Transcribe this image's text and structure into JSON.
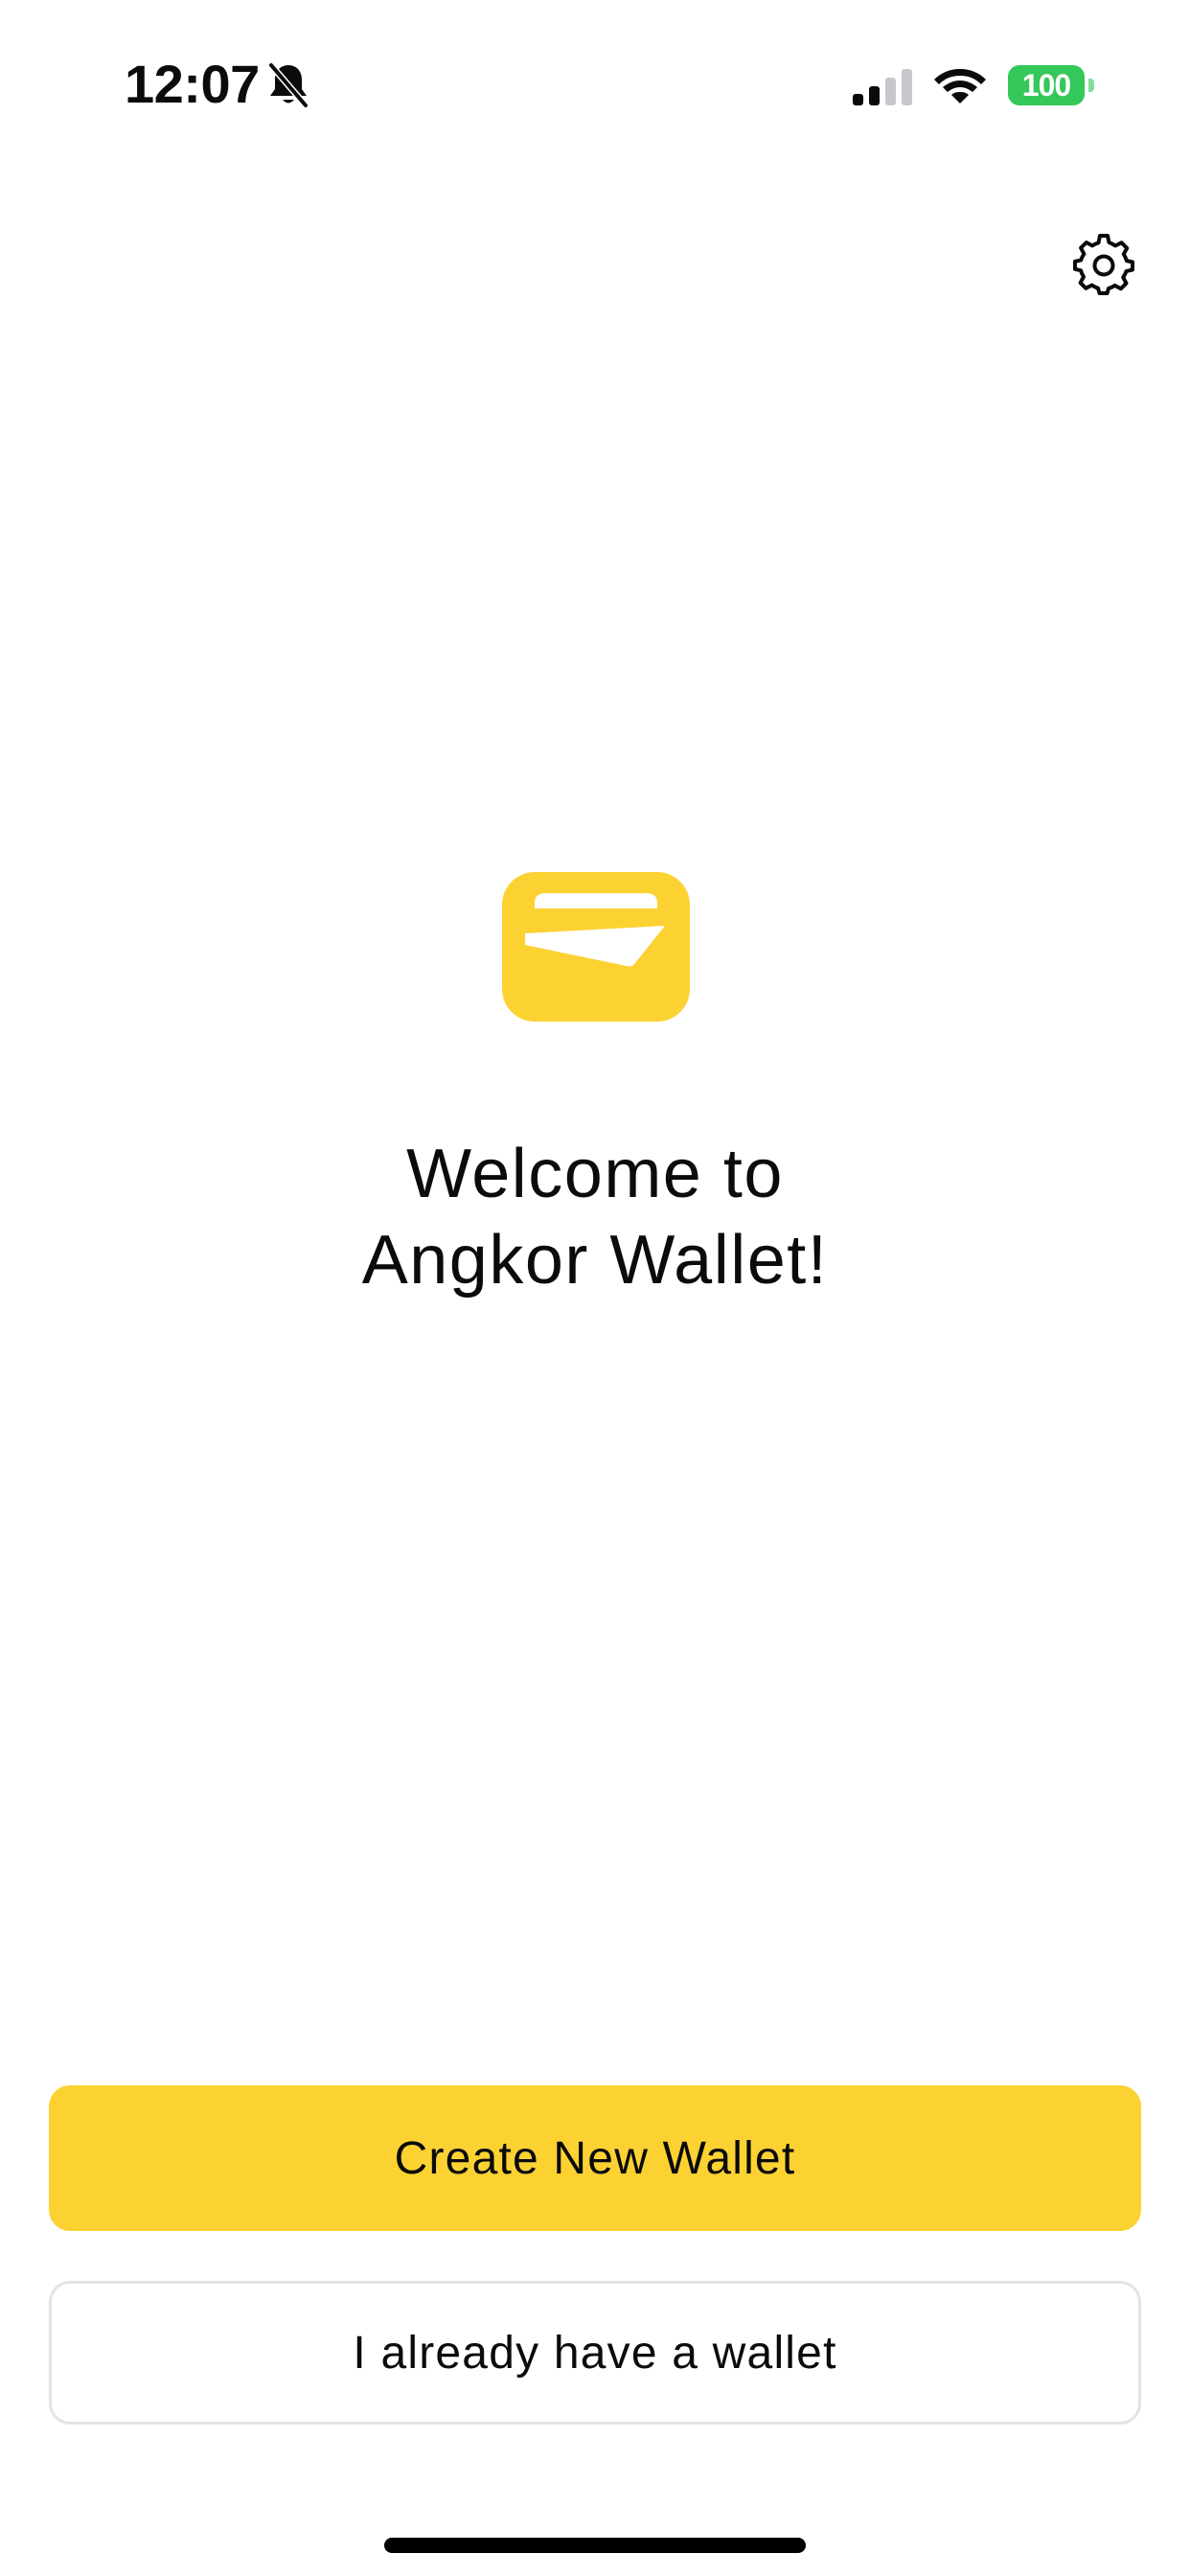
{
  "status_bar": {
    "time": "12:07",
    "battery_level": "100",
    "icons": [
      "bell-slash-icon",
      "cellular-signal-icon",
      "wifi-icon",
      "battery-icon"
    ],
    "signal_bars_filled": 2,
    "signal_bars_total": 4
  },
  "header": {
    "settings_icon": "gear-icon"
  },
  "hero": {
    "logo_icon": "wallet-icon",
    "title_line1": "Welcome to",
    "title_line2": "Angkor Wallet!"
  },
  "actions": {
    "create_label": "Create New Wallet",
    "import_label": "I already have a wallet"
  },
  "colors": {
    "brand_yellow": "#fcd233",
    "battery_green": "#34c759",
    "text": "#0b0b0b",
    "secondary_border": "#e3e3e6",
    "background": "#ffffff"
  }
}
